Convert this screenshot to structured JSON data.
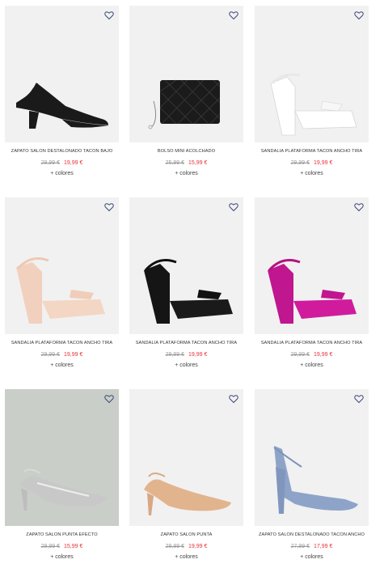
{
  "favorite_icon": "heart-outline-icon",
  "colors": {
    "heart": "#3a4a7a",
    "sale": "#e4323a",
    "old_price": "#9a9a9a",
    "image_bg": "#f1f1f1"
  },
  "products": [
    {
      "name": "ZAPATO SALÓN DESTALONADO TACÓN BAJO",
      "old_price": "29,99 €",
      "price": "19,99 €",
      "more": "+ colores"
    },
    {
      "name": "BOLSO MINI ACOLCHADO",
      "old_price": "25,99 €",
      "price": "15,99 €",
      "more": "+ colores"
    },
    {
      "name": "SANDALIA PLATAFORMA TACÓN ANCHO TIRA",
      "old_price": "29,99 €",
      "price": "19,99 €",
      "more": "+ colores"
    },
    {
      "name": "SANDALIA PLATAFORMA TACÓN ANCHO TIRA",
      "old_price": "29,99 €",
      "price": "19,99 €",
      "more": "+ colores"
    },
    {
      "name": "SANDALIA PLATAFORMA TACÓN ANCHO TIRA",
      "old_price": "29,99 €",
      "price": "19,99 €",
      "more": "+ colores"
    },
    {
      "name": "SANDALIA PLATAFORMA TACÓN ANCHO TIRA",
      "old_price": "29,99 €",
      "price": "19,99 €",
      "more": "+ colores"
    },
    {
      "name": "ZAPATO SALÓN PUNTA EFECTO",
      "old_price": "29,99 €",
      "price": "15,99 €",
      "more": "+ colores"
    },
    {
      "name": "ZAPATO SALÓN PUNTA",
      "old_price": "29,99 €",
      "price": "19,99 €",
      "more": "+ colores"
    },
    {
      "name": "ZAPATO SALÓN DESTALONADO TACÓN ANCHO",
      "old_price": "27,99 €",
      "price": "17,99 €",
      "more": "+ colores"
    }
  ]
}
